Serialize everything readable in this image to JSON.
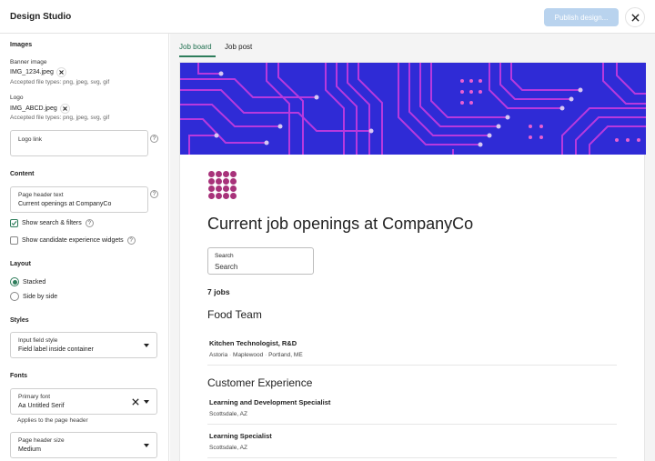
{
  "header": {
    "title": "Design Studio",
    "publish_label": "Publish design...",
    "close_icon": "close-icon"
  },
  "tabs": [
    {
      "label": "Job board",
      "active": true
    },
    {
      "label": "Job post",
      "active": false
    }
  ],
  "sidebar": {
    "images": {
      "title": "Images",
      "banner_label": "Banner image",
      "banner_file": "IMG_1234.jpeg",
      "banner_hint": "Accepted file types: png, jpeg, svg, gif",
      "logo_label": "Logo",
      "logo_file": "IMG_ABCD.jpeg",
      "logo_hint": "Accepted file types: png, jpeg, svg, gif",
      "logo_link_label": "Logo link",
      "logo_link_value": ""
    },
    "content": {
      "title": "Content",
      "page_header_label": "Page header text",
      "page_header_value": "Current openings at CompanyCo",
      "show_search_label": "Show search & filters",
      "show_search_checked": true,
      "show_widgets_label": "Show candidate experience widgets",
      "show_widgets_checked": false
    },
    "layout": {
      "title": "Layout",
      "options": [
        {
          "label": "Stacked",
          "selected": true
        },
        {
          "label": "Side by side",
          "selected": false
        }
      ]
    },
    "styles": {
      "title": "Styles",
      "input_field_label": "Input field style",
      "input_field_value": "Field label inside container"
    },
    "fonts": {
      "title": "Fonts",
      "primary_label": "Primary font",
      "primary_value": "Aa Untitled Serif",
      "primary_hint": "Applies to the page header",
      "size_label": "Page header size",
      "size_value": "Medium"
    },
    "help_char": "?"
  },
  "preview": {
    "page_header": "Current job openings at CompanyCo",
    "search_label": "Search",
    "search_value": "Search",
    "job_count": "7 jobs",
    "departments": [
      {
        "name": "Food Team",
        "jobs": [
          {
            "title": "Kitchen Technologist, R&D",
            "locations": [
              "Astoria",
              "Maplewood",
              "Portland, ME"
            ]
          }
        ]
      },
      {
        "name": "Customer Experience",
        "jobs": [
          {
            "title": "Learning and Development Specialist",
            "locations": [
              "Scottsdale, AZ"
            ]
          },
          {
            "title": "Learning Specialist",
            "locations": [
              "Scottsdale, AZ"
            ]
          }
        ]
      }
    ]
  },
  "colors": {
    "accent": "#2e7d5b",
    "banner_bg": "#2f2bd6",
    "banner_trace": "#c03adf",
    "publish_disabled": "#b9d3ee",
    "logo": "#a8327a"
  }
}
